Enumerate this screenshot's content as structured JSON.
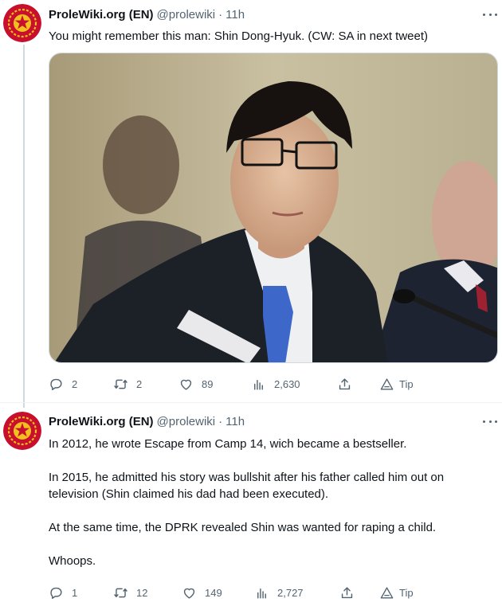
{
  "tweets": [
    {
      "author": {
        "name": "ProleWiki.org (EN)",
        "handle": "@prolewiki",
        "separator": "·",
        "time": "11h"
      },
      "paragraphs": [
        "You might remember this man: Shin Dong-Hyuk. (CW: SA in next tweet)"
      ],
      "has_media": true,
      "actions": {
        "replies": "2",
        "retweets": "2",
        "likes": "89",
        "views": "2,630",
        "tip_label": "Tip"
      }
    },
    {
      "author": {
        "name": "ProleWiki.org (EN)",
        "handle": "@prolewiki",
        "separator": "·",
        "time": "11h"
      },
      "paragraphs": [
        "In 2012, he wrote Escape from Camp 14, wich became a bestseller.",
        "In 2015, he admitted his story was bullshit after his father called him out on television (Shin claimed his dad had been executed).",
        "At the same time, the DPRK revealed Shin was wanted for raping a child.",
        "Whoops."
      ],
      "has_media": false,
      "actions": {
        "replies": "1",
        "retweets": "12",
        "likes": "149",
        "views": "2,727",
        "tip_label": "Tip"
      }
    }
  ],
  "icons": {
    "more": "more-horizontal-icon",
    "reply": "reply-icon",
    "retweet": "retweet-icon",
    "like": "heart-icon",
    "views": "analytics-icon",
    "share": "share-icon",
    "tip": "tip-icon"
  },
  "colors": {
    "avatar_bg": "#c8102e",
    "avatar_emblem": "#f2c01e",
    "icon_grey": "#536471",
    "text": "#0f1419",
    "thread_line": "#cfd9de"
  }
}
